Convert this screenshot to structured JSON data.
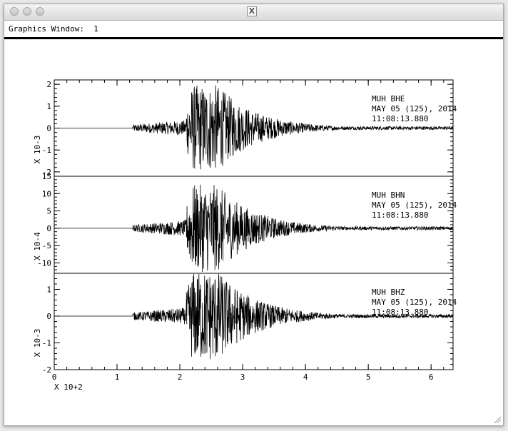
{
  "window": {
    "menu_text": "Graphics Window:  1",
    "title_icon": "x11-icon"
  },
  "panels": [
    {
      "station": "MUH  BHE",
      "date": "MAY 05 (125), 2014",
      "time": "11:08:13.880",
      "scale_label": "X 10-3",
      "yticks": [
        2,
        1,
        0,
        -1,
        -2
      ],
      "ylim": [
        -2.2,
        2.2
      ],
      "peak": 2.2
    },
    {
      "station": "MUH  BHN",
      "date": "MAY 05 (125), 2014",
      "time": "11:08:13.880",
      "scale_label": "X 10-4",
      "yticks": [
        15,
        10,
        5,
        0,
        -5,
        -10
      ],
      "ylim": [
        -13,
        15
      ],
      "peak": 14
    },
    {
      "station": "MUH  BHZ",
      "date": "MAY 05 (125), 2014",
      "time": "11:08:13.880",
      "scale_label": "X 10-3",
      "yticks": [
        1,
        0,
        -1,
        -2
      ],
      "ylim": [
        -2,
        1.6
      ],
      "peak": 1.9
    }
  ],
  "xaxis": {
    "ticks": [
      0,
      1,
      2,
      3,
      4,
      5,
      6
    ],
    "xlim": [
      0,
      6.35
    ],
    "scale_label": "X 10+2"
  },
  "chart_data": {
    "type": "line",
    "x_unit_label": "X 10+2",
    "x_range": [
      0,
      6.35
    ],
    "series_onset_x": 1.25,
    "series_peak_x": 2.3
  }
}
